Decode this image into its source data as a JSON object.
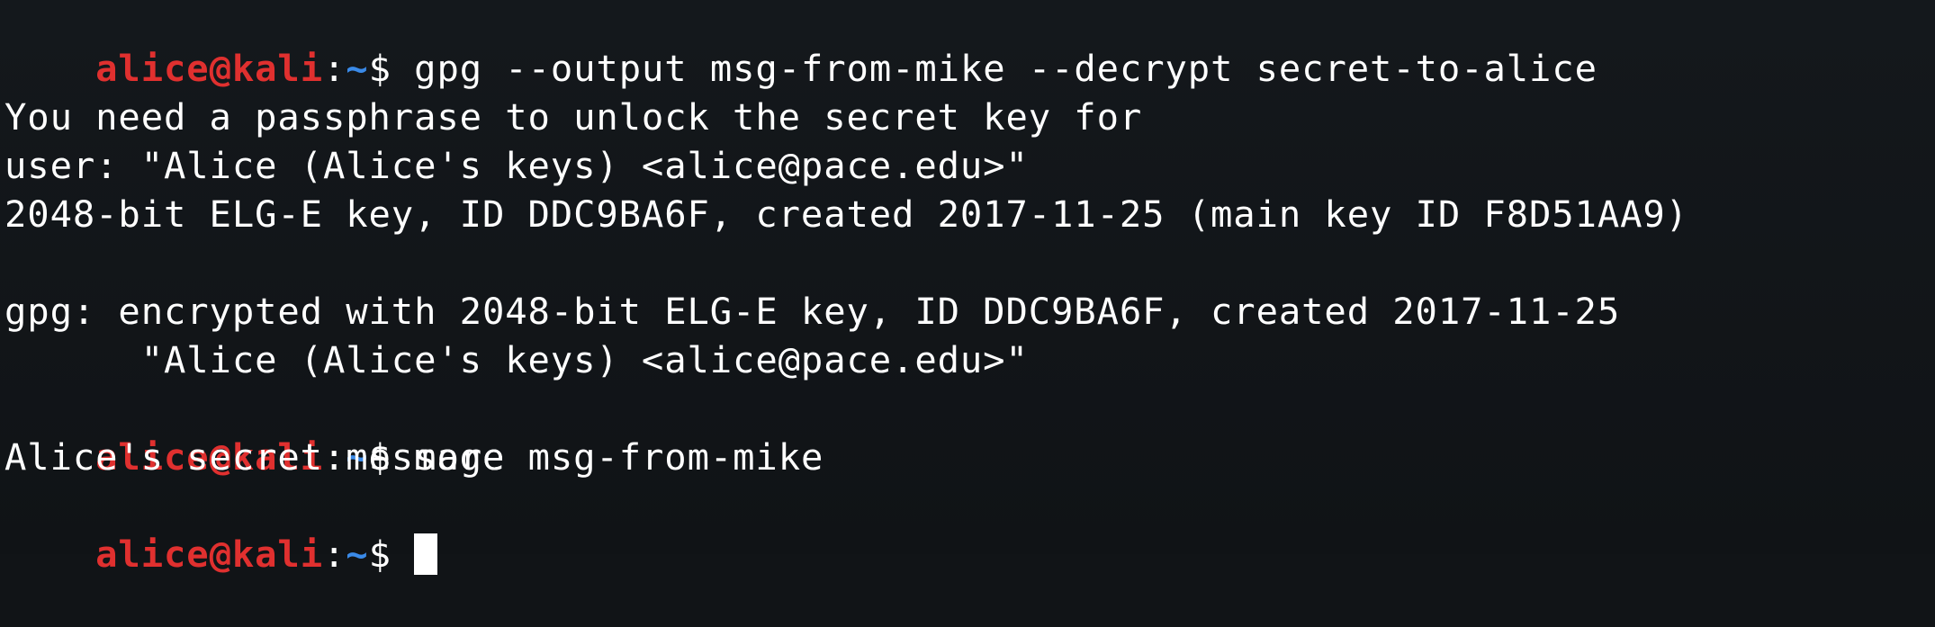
{
  "prompt": {
    "user": "alice",
    "at": "@",
    "host": "kali",
    "sep": ":",
    "path": "~",
    "symbol": "$ "
  },
  "lines": [
    {
      "type": "prompt",
      "command": "gpg --output msg-from-mike --decrypt secret-to-alice"
    },
    {
      "type": "blank",
      "text": ""
    },
    {
      "type": "output",
      "text": "You need a passphrase to unlock the secret key for"
    },
    {
      "type": "output",
      "text": "user: \"Alice (Alice's keys) <alice@pace.edu>\""
    },
    {
      "type": "output",
      "text": "2048-bit ELG-E key, ID DDC9BA6F, created 2017-11-25 (main key ID F8D51AA9)"
    },
    {
      "type": "blank",
      "text": ""
    },
    {
      "type": "output",
      "text": "gpg: encrypted with 2048-bit ELG-E key, ID DDC9BA6F, created 2017-11-25"
    },
    {
      "type": "output",
      "text": "      \"Alice (Alice's keys) <alice@pace.edu>\""
    },
    {
      "type": "prompt",
      "command": "more msg-from-mike"
    },
    {
      "type": "output",
      "text": "Alice's secret message"
    },
    {
      "type": "prompt",
      "command": ""
    }
  ],
  "colors": {
    "background": "#111417",
    "prompt_user_host": "#e0302f",
    "prompt_path": "#3a8ae8",
    "text": "#ffffff"
  },
  "cursor": "block-cursor"
}
